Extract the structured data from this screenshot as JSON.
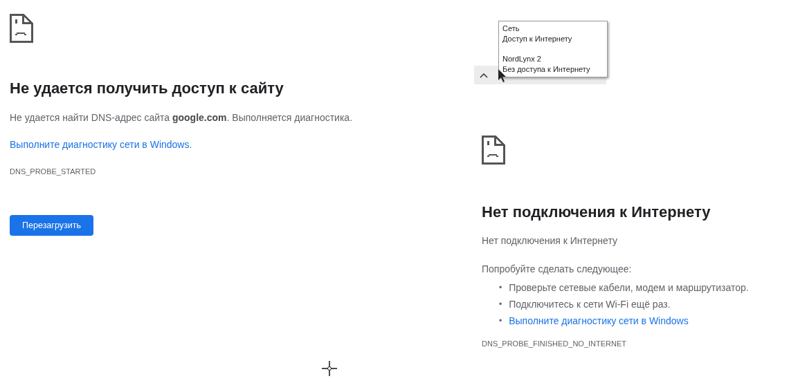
{
  "left_page": {
    "title": "Не удается получить доступ к сайту",
    "message": "Не удается найти DNS-адрес сайта **google.com**. Выполняется диагностика.",
    "link": "Выполните диагностику сети в Windows.",
    "error_code": "DNS_PROBE_STARTED",
    "button": "Перезагрузить"
  },
  "tray_tooltip": {
    "networks": [
      {
        "name": "Сеть",
        "status": "Доступ к Интернету"
      },
      {
        "name": "NordLynx 2",
        "status": "Без доступа к Интернету"
      }
    ]
  },
  "right_page": {
    "title": "Нет подключения к Интернету",
    "message": "Нет подключения к Интернету",
    "suggestions_heading": "Попробуйте сделать следующее:",
    "suggestions": [
      {
        "kind": "text",
        "bullet": "•",
        "text": "Проверьте сетевые кабели, модем и маршрутизатор."
      },
      {
        "kind": "text",
        "bullet": "•",
        "text": "Подключитесь к сети Wi-Fi ещё раз."
      },
      {
        "kind": "link",
        "bullet": "•",
        "text": "Выполните диагностику сети в Windows"
      }
    ],
    "error_code": "DNS_PROBE_FINISHED_NO_INTERNET"
  }
}
